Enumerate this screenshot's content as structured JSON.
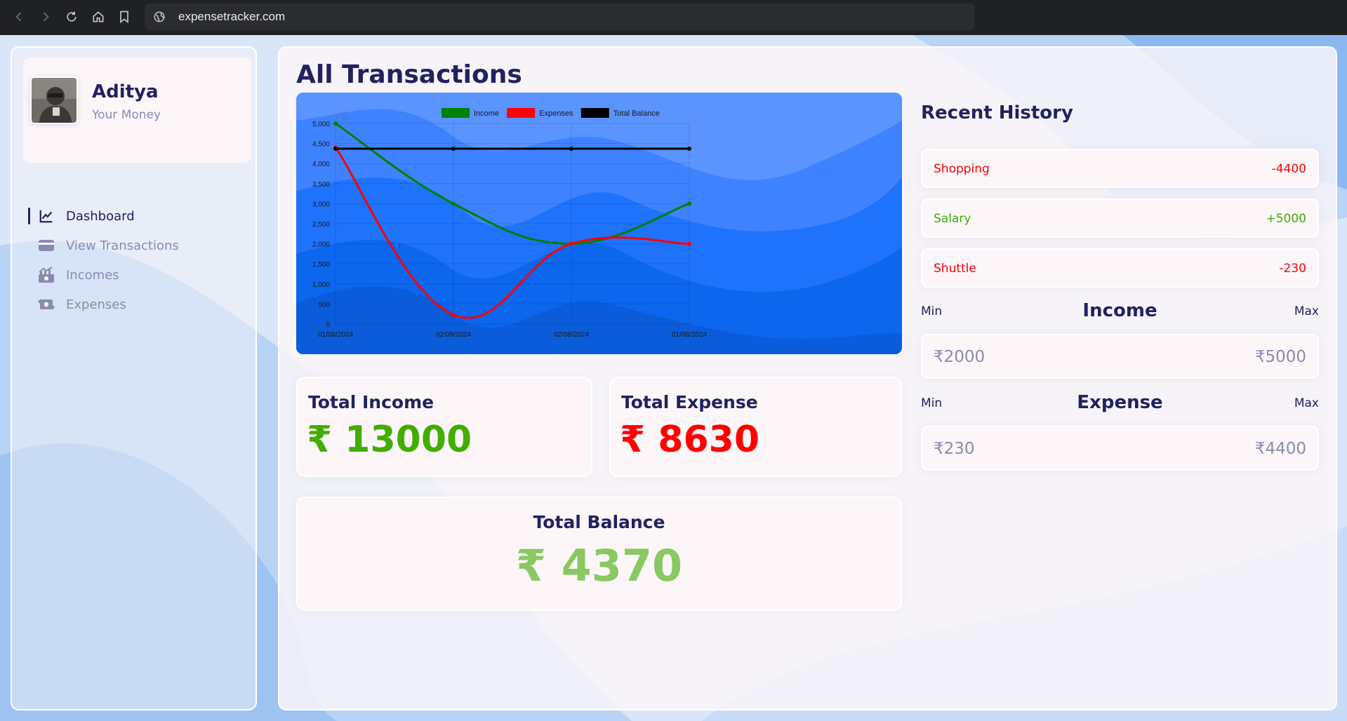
{
  "browser": {
    "url": "expensetracker.com"
  },
  "user": {
    "name": "Aditya",
    "subtitle": "Your Money"
  },
  "menu": {
    "items": [
      {
        "label": "Dashboard",
        "icon": "line-chart-icon",
        "active": true
      },
      {
        "label": "View Transactions",
        "icon": "credit-card-icon",
        "active": false
      },
      {
        "label": "Incomes",
        "icon": "money-bill-trend-icon",
        "active": false
      },
      {
        "label": "Expenses",
        "icon": "money-bill-transfer-icon",
        "active": false
      }
    ]
  },
  "main": {
    "title": "All Transactions",
    "total_income": {
      "title": "Total Income",
      "value": "₹ 13000",
      "color": "#42ad00"
    },
    "total_expense": {
      "title": "Total Expense",
      "value": "₹ 8630",
      "color": "#ff0000"
    },
    "total_balance": {
      "title": "Total Balance",
      "value": "₹ 4370",
      "color": "#8ac862"
    }
  },
  "history": {
    "title": "Recent History",
    "items": [
      {
        "label": "Shopping",
        "amount": "-4400",
        "color": "#ff0000"
      },
      {
        "label": "Salary",
        "amount": "+5000",
        "color": "#42ad00"
      },
      {
        "label": "Shuttle",
        "amount": "-230",
        "color": "#ff0000"
      }
    ]
  },
  "ranges": {
    "income": {
      "title": "Income",
      "min_label": "Min",
      "max_label": "Max",
      "min": "₹2000",
      "max": "₹5000"
    },
    "expense": {
      "title": "Expense",
      "min_label": "Min",
      "max_label": "Max",
      "min": "₹230",
      "max": "₹4400"
    }
  },
  "colors": {
    "primary": "#222260",
    "muted": "#8a8ab0",
    "card_bg": "#fcf6f9",
    "income": "#42ad00",
    "expense": "#ff0000"
  },
  "chart_data": {
    "type": "line",
    "x": [
      "01/08/2024",
      "02/08/2024",
      "02/08/2024",
      "01/08/2024"
    ],
    "ylim": [
      0,
      5000
    ],
    "yticks": [
      0,
      500,
      1000,
      1500,
      2000,
      2500,
      3000,
      3500,
      4000,
      4500,
      5000
    ],
    "ytick_labels": [
      "0",
      "500",
      "1,000",
      "1,500",
      "2,000",
      "2,500",
      "3,000",
      "3,500",
      "4,000",
      "4,500",
      "5,000"
    ],
    "legend": "top",
    "grid": true,
    "series": [
      {
        "name": "Income",
        "color": "#008000",
        "values": [
          5000,
          3000,
          2000,
          3000
        ]
      },
      {
        "name": "Expenses",
        "color": "#ff0000",
        "values": [
          4400,
          230,
          2000,
          2000
        ]
      },
      {
        "name": "Total Balance",
        "color": "#000000",
        "values": [
          4370,
          4370,
          4370,
          4370
        ]
      }
    ]
  }
}
